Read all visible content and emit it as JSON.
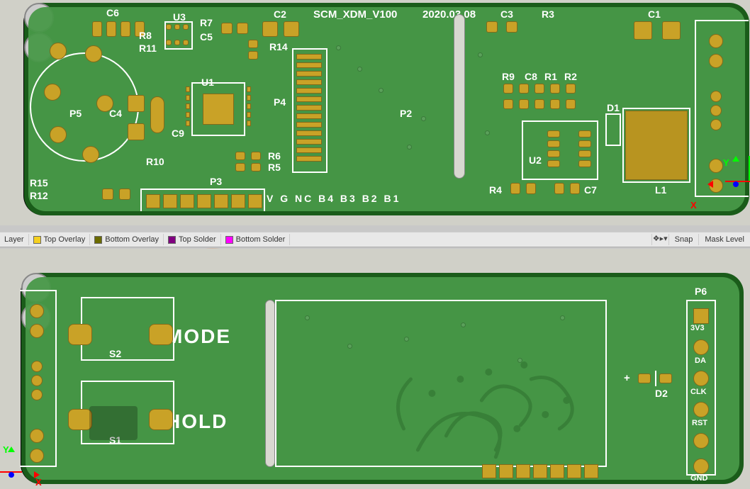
{
  "board": {
    "title": "SCM_XDM_V100",
    "date": "2020.03.08"
  },
  "toolbar": {
    "layer_label": "Layer",
    "top_overlay": "Top Overlay",
    "bottom_overlay": "Bottom Overlay",
    "top_solder": "Top Solder",
    "bottom_solder": "Bottom Solder",
    "filter_icons": "❖▸▾",
    "snap": "Snap",
    "mask_level": "Mask Level"
  },
  "top": {
    "designators": {
      "C1": "C1",
      "C2": "C2",
      "C3": "C3",
      "C4": "C4",
      "C5": "C5",
      "C6": "C6",
      "C7": "C7",
      "C8": "C8",
      "C9": "C9",
      "R1": "R1",
      "R2": "R2",
      "R3": "R3",
      "R4": "R4",
      "R5": "R5",
      "R6": "R6",
      "R7": "R7",
      "R8": "R8",
      "R9": "R9",
      "R10": "R10",
      "R11": "R11",
      "R12": "R12",
      "R14": "R14",
      "R15": "R15",
      "U1": "U1",
      "U2": "U2",
      "U3": "U3",
      "D1": "D1",
      "L1": "L1",
      "P2": "P2",
      "P3": "P3",
      "P4": "P4",
      "P5": "P5"
    },
    "pin_row": "V G NC B4 B3 B2 B1"
  },
  "bottom": {
    "designators": {
      "S1": "S1",
      "S2": "S2",
      "D2": "D2",
      "P6": "P6"
    },
    "labels": {
      "mode": "MODE",
      "hold": "HOLD",
      "plus": "+",
      "p6_3v3": "3V3",
      "p6_da": "DA",
      "p6_clk": "CLK",
      "p6_rst": "RST",
      "p6_gnd": "GND"
    }
  },
  "axis": {
    "x": "X",
    "y": "Y"
  },
  "colors": {
    "pcb_green": "#1a5c1a",
    "copper_fill": "#489848",
    "pad_gold": "#c9a227",
    "silk_white": "#ffffff"
  }
}
